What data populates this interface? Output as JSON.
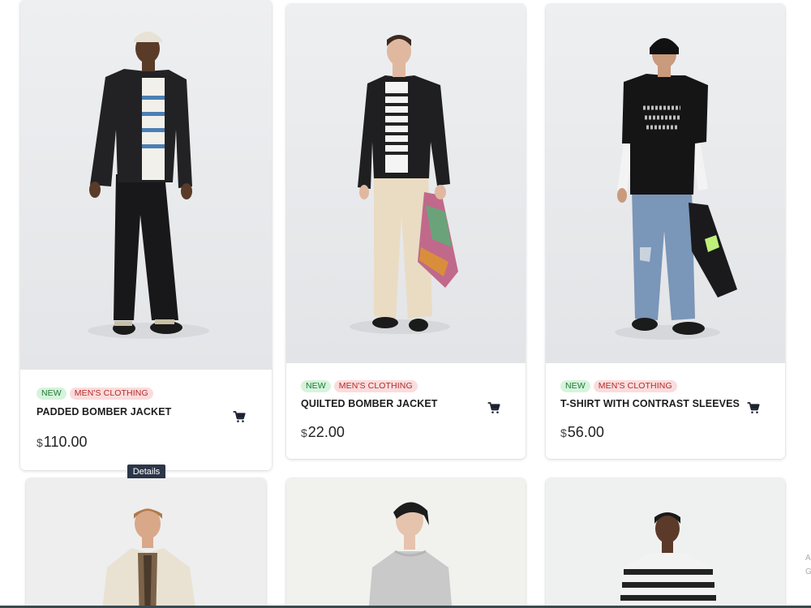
{
  "products": [
    {
      "badge_new": "NEW",
      "category": "MEN'S CLOTHING",
      "name": "PADDED BOMBER JACKET",
      "currency": "$",
      "price": "110.00"
    },
    {
      "badge_new": "NEW",
      "category": "MEN'S CLOTHING",
      "name": "QUILTED BOMBER JACKET",
      "currency": "$",
      "price": "22.00"
    },
    {
      "badge_new": "NEW",
      "category": "MEN'S CLOTHING",
      "name": "T-SHIRT WITH CONTRAST SLEEVES",
      "currency": "$",
      "price": "56.00"
    }
  ],
  "tooltip": {
    "label": "Details"
  },
  "edge": {
    "line1": "A",
    "line2": "G"
  },
  "icons": {
    "cart": "cart-icon"
  },
  "colors": {
    "badge_new_bg": "#d6f3dc",
    "badge_new_text": "#1d7a35",
    "badge_cat_bg": "#fbdcdc",
    "badge_cat_text": "#b12c2c",
    "tooltip_bg": "#2c3648"
  }
}
